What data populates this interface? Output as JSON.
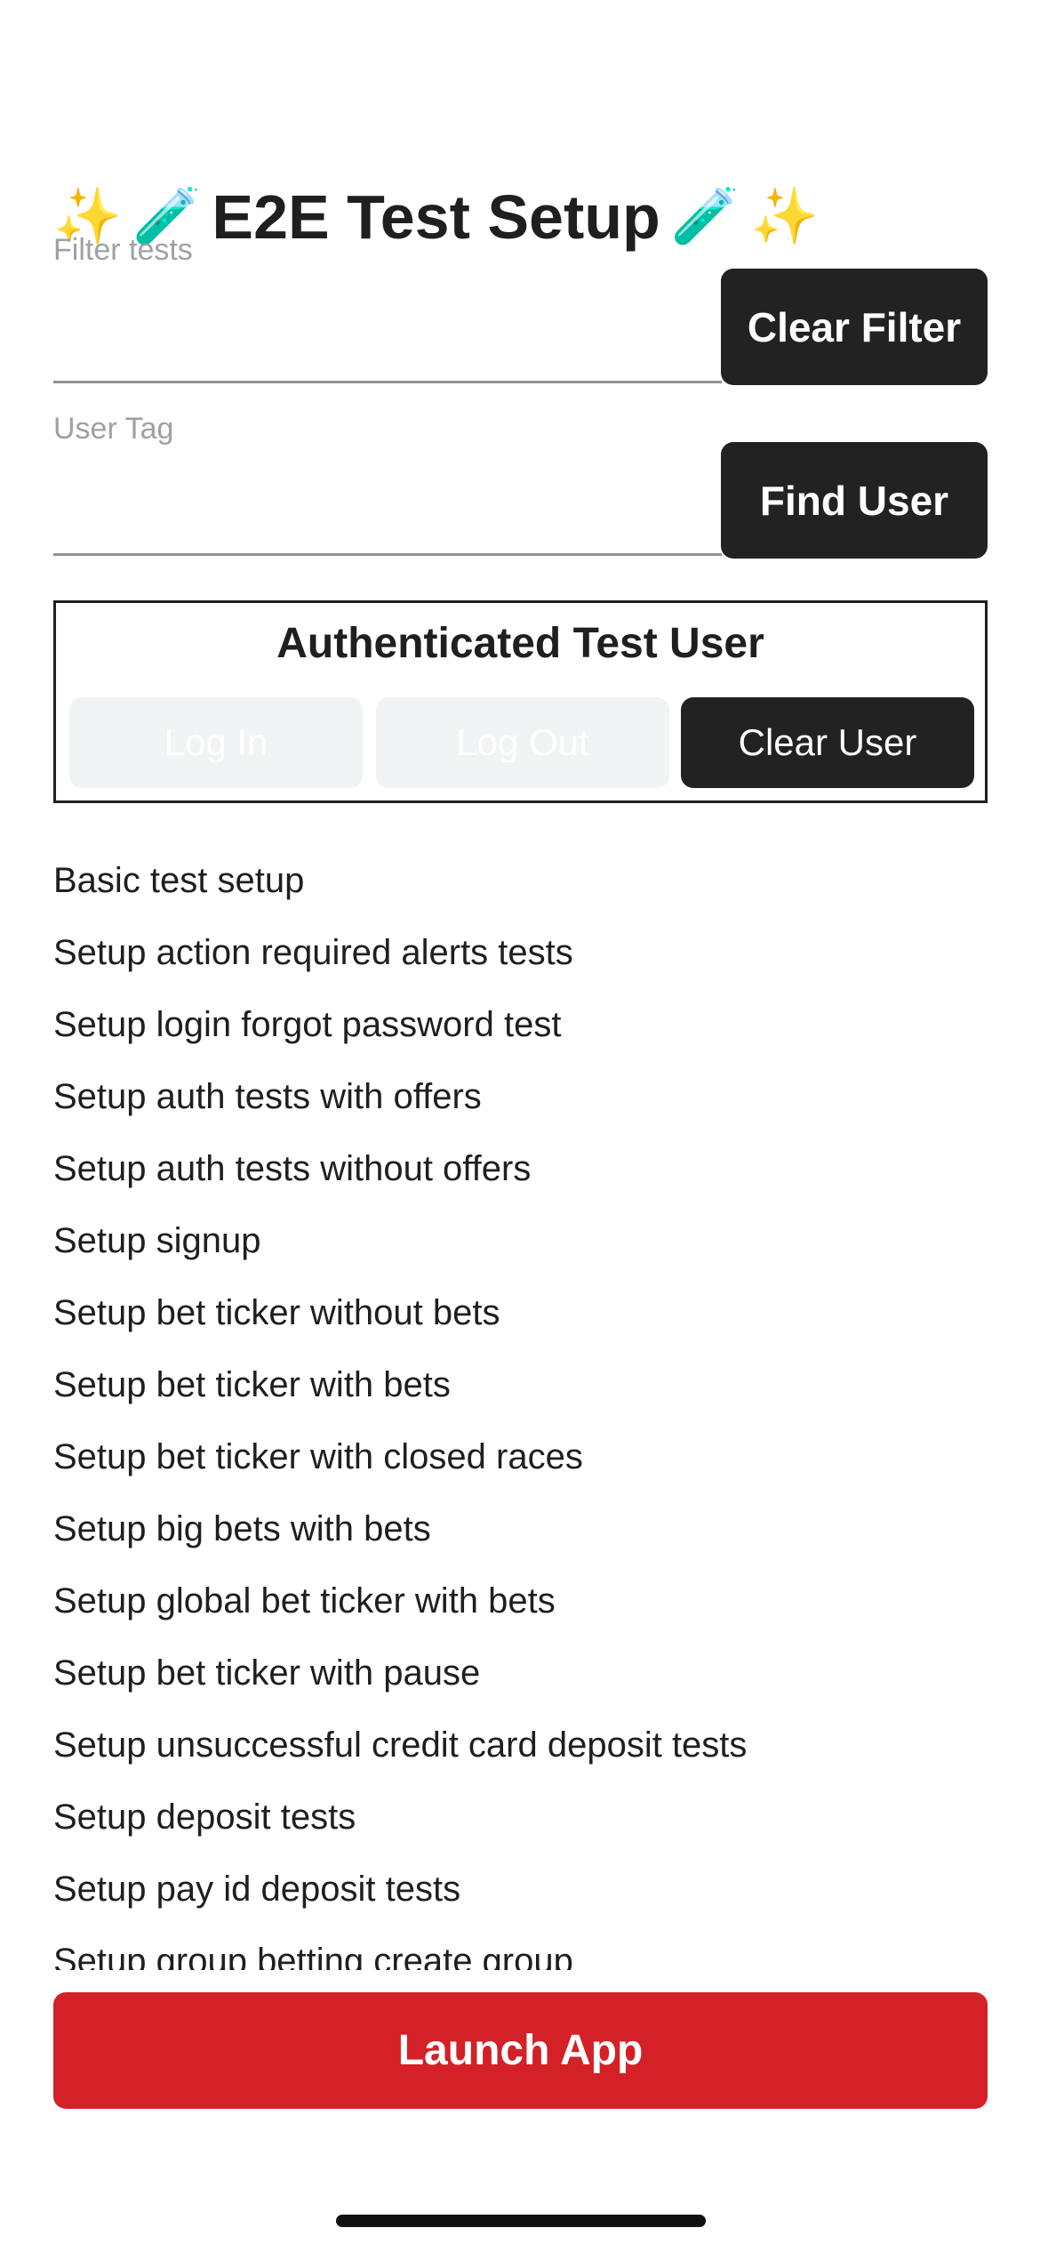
{
  "header": {
    "title": "E2E Test Setup",
    "sparkles": "✨",
    "test_tube": "🧪"
  },
  "filter": {
    "label": "Filter tests",
    "value": "",
    "button_label": "Clear Filter"
  },
  "user_tag": {
    "label": "User Tag",
    "value": "",
    "button_label": "Find User"
  },
  "auth": {
    "title": "Authenticated Test User",
    "login_label": "Log In",
    "logout_label": "Log Out",
    "clear_label": "Clear User"
  },
  "tests": [
    "Basic test setup",
    "Setup action required alerts tests",
    "Setup login forgot password test",
    "Setup auth tests with offers",
    "Setup auth tests without offers",
    "Setup signup",
    "Setup bet ticker without bets",
    "Setup bet ticker with bets",
    "Setup bet ticker with closed races",
    "Setup big bets with bets",
    "Setup global bet ticker with bets",
    "Setup bet ticker with pause",
    "Setup unsuccessful credit card deposit tests",
    "Setup deposit tests",
    "Setup pay id deposit tests",
    "Setup group betting create group"
  ],
  "launch_label": "Launch App",
  "colors": {
    "accent": "#d42027",
    "dark_button": "#222222",
    "disabled_button": "#f2f3f5"
  }
}
